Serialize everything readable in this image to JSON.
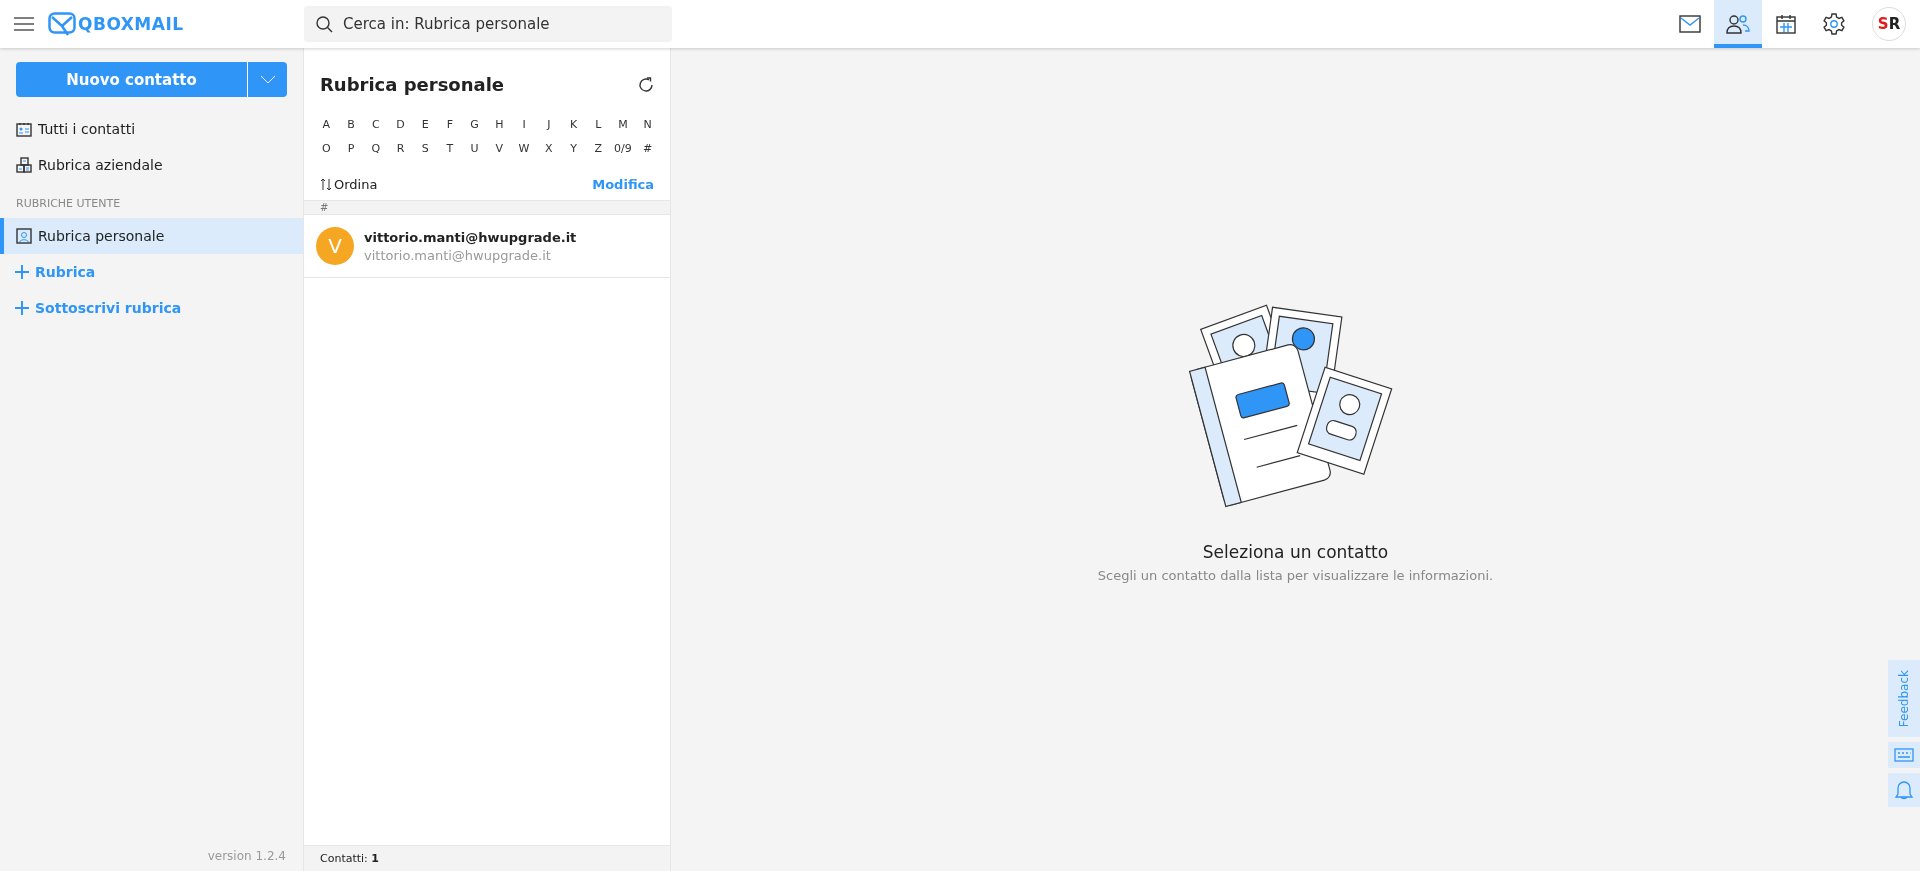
{
  "header": {
    "logo": "QBOXMAIL",
    "search": {
      "placeholder": "Cerca in: Rubrica personale"
    },
    "nav": [
      {
        "kind": "mail",
        "selected": false
      },
      {
        "kind": "contacts",
        "selected": true
      },
      {
        "kind": "calendar",
        "selected": false
      },
      {
        "kind": "settings",
        "selected": false
      }
    ],
    "avatar": "SR"
  },
  "sidebar": {
    "new_button": "Nuovo contatto",
    "items": [
      {
        "kind": "all",
        "label": "Tutti i contatti",
        "selected": false
      },
      {
        "kind": "company",
        "label": "Rubrica aziendale",
        "selected": false
      }
    ],
    "section": "RUBRICHE UTENTE",
    "books": [
      {
        "kind": "personal",
        "label": "Rubrica personale",
        "selected": true
      }
    ],
    "actions": [
      "Rubrica",
      "Sottoscrivi rubrica"
    ],
    "version": "version 1.2.4"
  },
  "list": {
    "title": "Rubrica personale",
    "letters": [
      "A",
      "B",
      "C",
      "D",
      "E",
      "F",
      "G",
      "H",
      "I",
      "J",
      "K",
      "L",
      "M",
      "N",
      "O",
      "P",
      "Q",
      "R",
      "S",
      "T",
      "U",
      "V",
      "W",
      "X",
      "Y",
      "Z",
      "0/9",
      "#"
    ],
    "sort": "Ordina",
    "edit": "Modifica",
    "group": "#",
    "contacts": [
      {
        "initial": "V",
        "name": "vittorio.manti@hwupgrade.it",
        "email": "vittorio.manti@hwupgrade.it"
      }
    ],
    "footer": "Contatti: **1**"
  },
  "detail": {
    "title": "Seleziona un contatto",
    "subtitle": "Scegli un contatto dalla lista per visualizzare le informazioni."
  },
  "side_tabs": [
    {
      "kind": "feedback",
      "label": "Feedback"
    },
    {
      "kind": "keyboard"
    },
    {
      "kind": "help"
    }
  ]
}
